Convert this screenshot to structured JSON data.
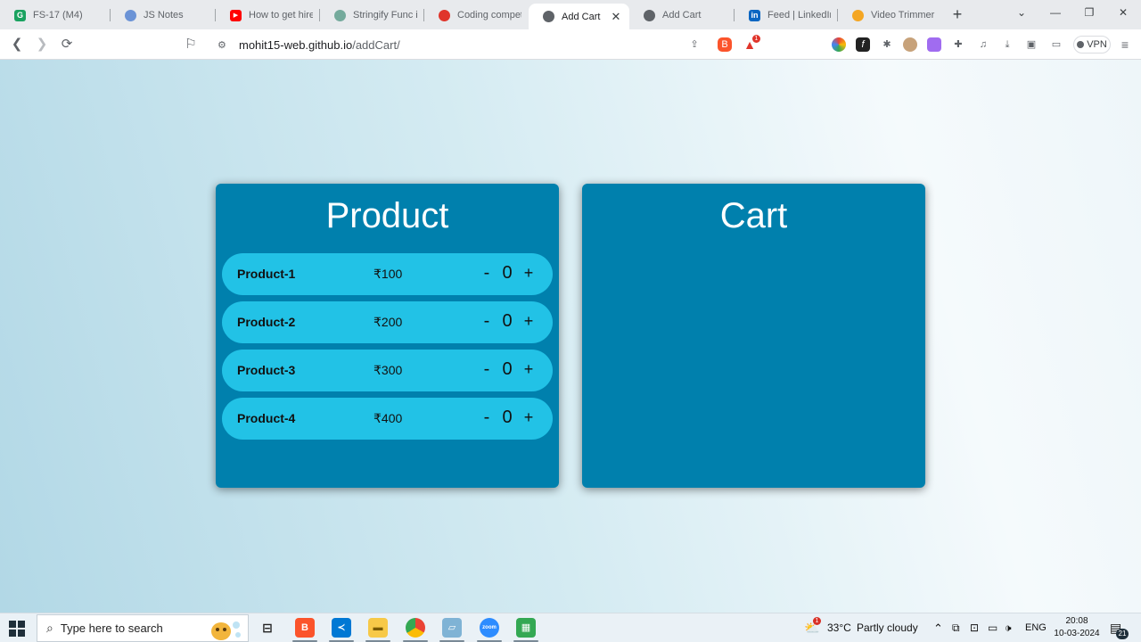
{
  "browser": {
    "tabs": [
      {
        "title": "FS-17 (M4)",
        "icon": "g-logo-icon",
        "color": "#1aa260"
      },
      {
        "title": "JS Notes",
        "icon": "notes-icon",
        "color": "#6b93d6"
      },
      {
        "title": "How to get hired",
        "icon": "youtube-icon",
        "color": "#ff0000"
      },
      {
        "title": "Stringify Func in J",
        "icon": "chatgpt-icon",
        "color": "#74aa9c"
      },
      {
        "title": "Coding competiti",
        "icon": "fire-icon",
        "color": "#e0352b"
      },
      {
        "title": "Add Cart",
        "icon": "globe-icon",
        "color": "#5f6368",
        "active": true
      },
      {
        "title": "Add Cart",
        "icon": "globe-icon",
        "color": "#5f6368"
      },
      {
        "title": "Feed | LinkedIn",
        "icon": "linkedin-icon",
        "color": "#0a66c2"
      },
      {
        "title": "Video Trimmer - C",
        "icon": "video-trimmer-icon",
        "color": "#f4a623"
      }
    ],
    "url_host": "mohit15-web.github.io",
    "url_path": "/addCart/",
    "vpn_label": "VPN",
    "brave_badge": "1"
  },
  "page": {
    "product_title": "Product",
    "cart_title": "Cart",
    "products": [
      {
        "name": "Product-1",
        "price": "₹100",
        "qty": "0"
      },
      {
        "name": "Product-2",
        "price": "₹200",
        "qty": "0"
      },
      {
        "name": "Product-3",
        "price": "₹300",
        "qty": "0"
      },
      {
        "name": "Product-4",
        "price": "₹400",
        "qty": "0"
      }
    ],
    "minus_label": "-",
    "plus_label": "+"
  },
  "taskbar": {
    "search_placeholder": "Type here to search",
    "weather_temp": "33°C",
    "weather_text": "Partly cloudy",
    "weather_badge": "1",
    "language": "ENG",
    "time": "20:08",
    "date": "10-03-2024",
    "notifications": "21"
  }
}
